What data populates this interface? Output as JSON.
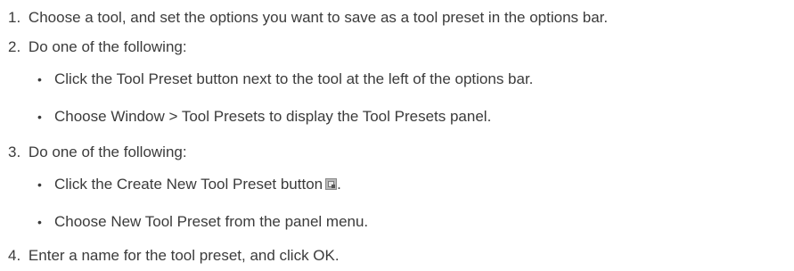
{
  "steps": [
    {
      "number": "1.",
      "text": "Choose a tool, and set the options you want to save as a tool preset in the options bar."
    },
    {
      "number": "2.",
      "text": "Do one of the following:",
      "bullets": [
        "Click the Tool Preset button next to the tool at the left of the options bar.",
        "Choose Window > Tool Presets to display the Tool Presets panel."
      ]
    },
    {
      "number": "3.",
      "text": "Do one of the following:",
      "bullets": [
        "Click the Create New Tool Preset button",
        "Choose New Tool Preset from the panel menu."
      ],
      "bullet_suffix": "."
    },
    {
      "number": "4.",
      "text": "Enter a name for the tool preset, and click OK."
    }
  ],
  "icons": {
    "create_new_preset": "new-preset-icon"
  }
}
